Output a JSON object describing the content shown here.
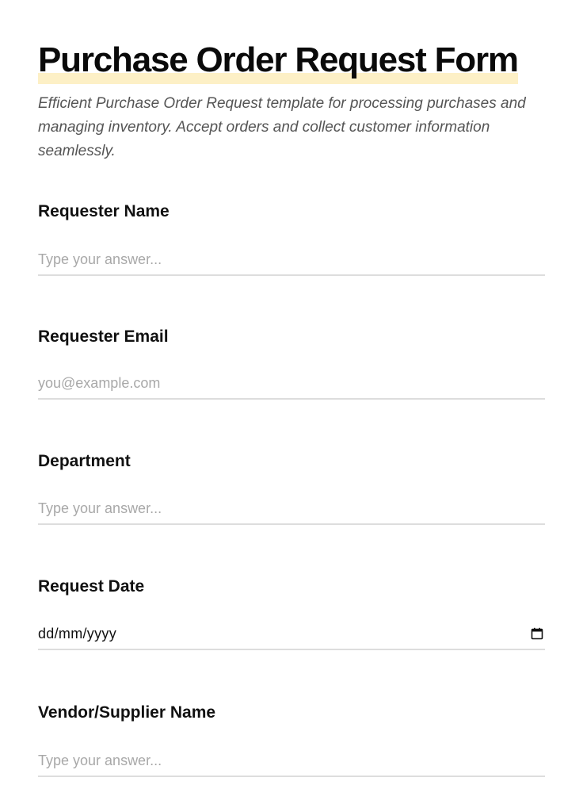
{
  "form": {
    "title": "Purchase Order Request Form",
    "description": "Efficient Purchase Order Request template for processing purchases and managing inventory. Accept orders and collect customer information seamlessly.",
    "highlight_color": "#fdf0c6"
  },
  "fields": [
    {
      "label": "Requester Name",
      "placeholder": "Type your answer..."
    },
    {
      "label": "Requester Email",
      "placeholder": "you@example.com"
    },
    {
      "label": "Department",
      "placeholder": "Type your answer..."
    },
    {
      "label": "Request Date",
      "value": "dd/mm/yyyy",
      "icon": "calendar-icon"
    },
    {
      "label": "Vendor/Supplier Name",
      "placeholder": "Type your answer..."
    }
  ]
}
